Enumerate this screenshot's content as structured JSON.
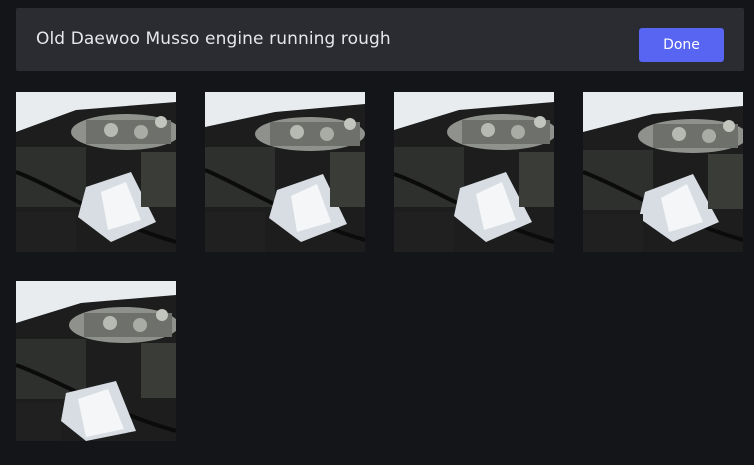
{
  "header": {
    "title": "Old Daewoo Musso engine running rough",
    "done_label": "Done"
  },
  "photos": [
    {
      "alt": "engine photo 1"
    },
    {
      "alt": "engine photo 2"
    },
    {
      "alt": "engine photo 3"
    },
    {
      "alt": "engine photo 4"
    },
    {
      "alt": "engine photo 5"
    }
  ],
  "colors": {
    "background": "#141519",
    "header": "#2a2c31",
    "accent": "#5865f2"
  }
}
